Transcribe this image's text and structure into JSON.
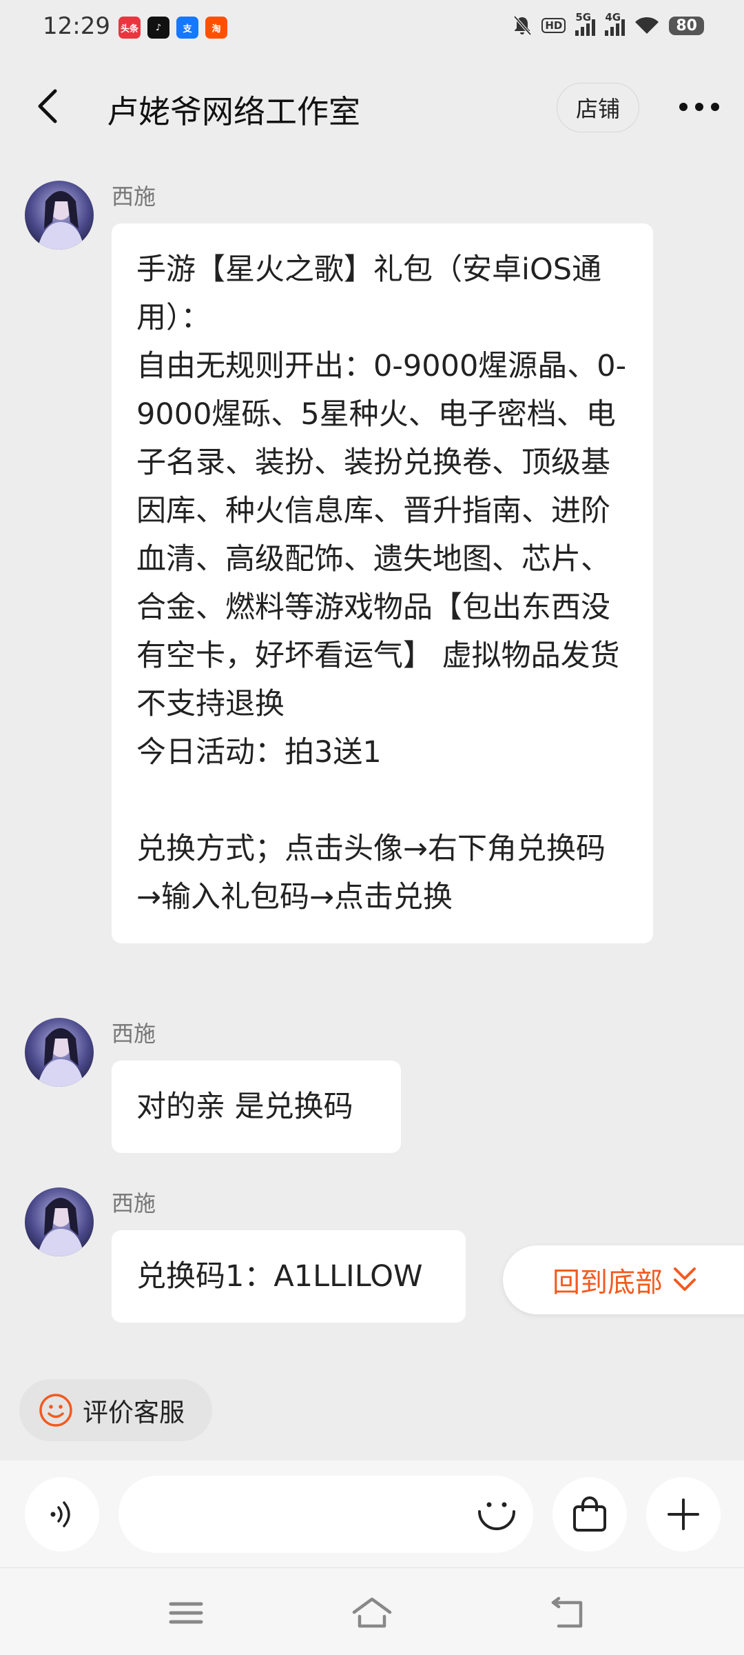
{
  "status_bar": {
    "time": "12:29",
    "app_icons": [
      {
        "name": "toutiao-app-icon",
        "label": "头条",
        "color": "#e8363f"
      },
      {
        "name": "tiktok-app-icon",
        "label": "♪",
        "color": "#111111"
      },
      {
        "name": "alipay-app-icon",
        "label": "支",
        "color": "#1677ff"
      },
      {
        "name": "taobao-app-icon",
        "label": "淘",
        "color": "#ff5000"
      }
    ],
    "network_1": "5G",
    "network_2": "4G",
    "battery": "80"
  },
  "header": {
    "title": "卢姥爷网络工作室",
    "shop_button": "店铺"
  },
  "messages": [
    {
      "sender": "西施",
      "text": "手游【星火之歌】礼包（安卓iOS通用）：\n自由无规则开出：0-9000煋源晶、0-9000煋砾、5星种火、电子密档、电子名录、装扮、装扮兑换卷、顶级基因库、种火信息库、晋升指南、进阶血清、高级配饰、遗失地图、芯片、合金、燃料等游戏物品【包出东西没有空卡，好坏看运气】 虚拟物品发货不支持退换\n今日活动：拍3送1\n\n兑换方式；点击头像→右下角兑换码→输入礼包码→点击兑换"
    },
    {
      "sender": "西施",
      "text": "对的亲 是兑换码"
    },
    {
      "sender": "西施",
      "text": "兑换码1：A1LLILOW"
    }
  ],
  "back_to_bottom": "回到底部",
  "rate_service": "评价客服",
  "input": {
    "placeholder": ""
  },
  "colors": {
    "accent": "#f25a1f",
    "background": "#ededed",
    "bubble": "#ffffff"
  }
}
